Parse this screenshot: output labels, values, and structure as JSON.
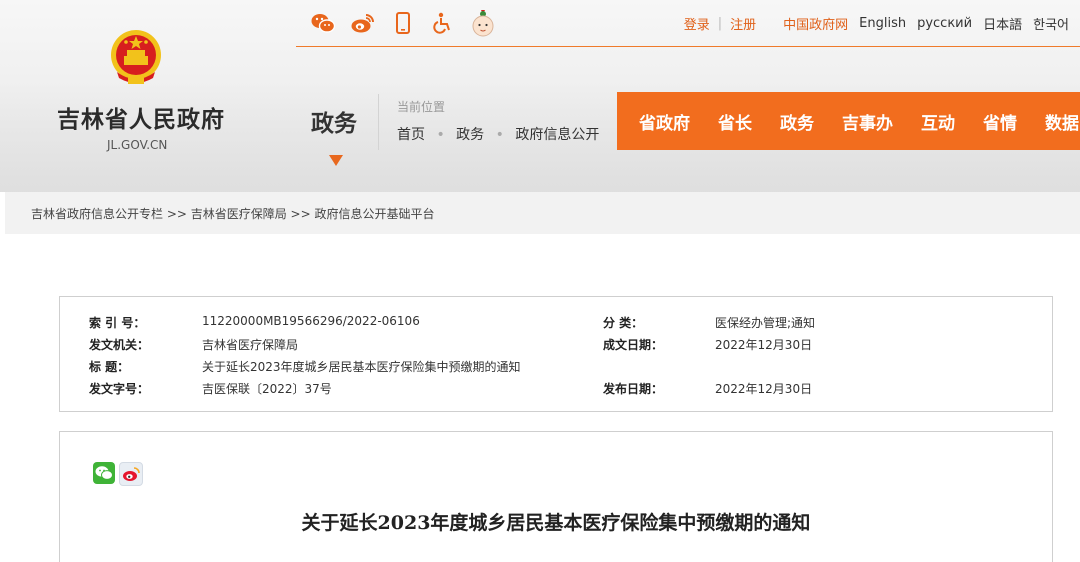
{
  "site": {
    "name": "吉林省人民政府",
    "domain": "JL.GOV.CN"
  },
  "top_icons": [
    "wechat-icon",
    "weibo-icon",
    "mobile-icon",
    "accessibility-icon",
    "mascot-icon"
  ],
  "top_links": {
    "login": "登录",
    "register": "注册",
    "china_gov": "中国政府网",
    "english": "English",
    "russian": "русский",
    "japanese": "日本語",
    "korean": "한국어"
  },
  "channel": "政务",
  "location": {
    "label": "当前位置",
    "crumbs": [
      "首页",
      "政务",
      "政府信息公开"
    ]
  },
  "nav": [
    "省政府",
    "省长",
    "政务",
    "吉事办",
    "互动",
    "省情",
    "数据"
  ],
  "breadcrumb": "吉林省政府信息公开专栏 >> 吉林省医疗保障局 >> 政府信息公开基础平台",
  "info": {
    "index_label": "索 引 号：",
    "index_value": "11220000MB19566296/2022-06106",
    "category_label": "分    类：",
    "category_value": "医保经办管理;通知",
    "issuer_label": "发文机关：",
    "issuer_value": "吉林省医疗保障局",
    "date_label": "成文日期：",
    "date_value": "2022年12月30日",
    "title_label": "标    题：",
    "title_value": "关于延长2023年度城乡居民基本医疗保险集中预缴期的通知",
    "docno_label": "发文字号：",
    "docno_value": "吉医保联〔2022〕37号",
    "publish_label": "发布日期：",
    "publish_value": "2022年12月30日"
  },
  "share_icons": [
    "wechat-share-icon",
    "weibo-share-icon"
  ],
  "doc_title": "关于延长2023年度城乡居民基本医疗保险集中预缴期的通知",
  "colors": {
    "accent": "#f26d1e",
    "link_orange": "#e0611a",
    "emblem_red": "#d71e1e",
    "emblem_gold": "#f2c21b"
  }
}
